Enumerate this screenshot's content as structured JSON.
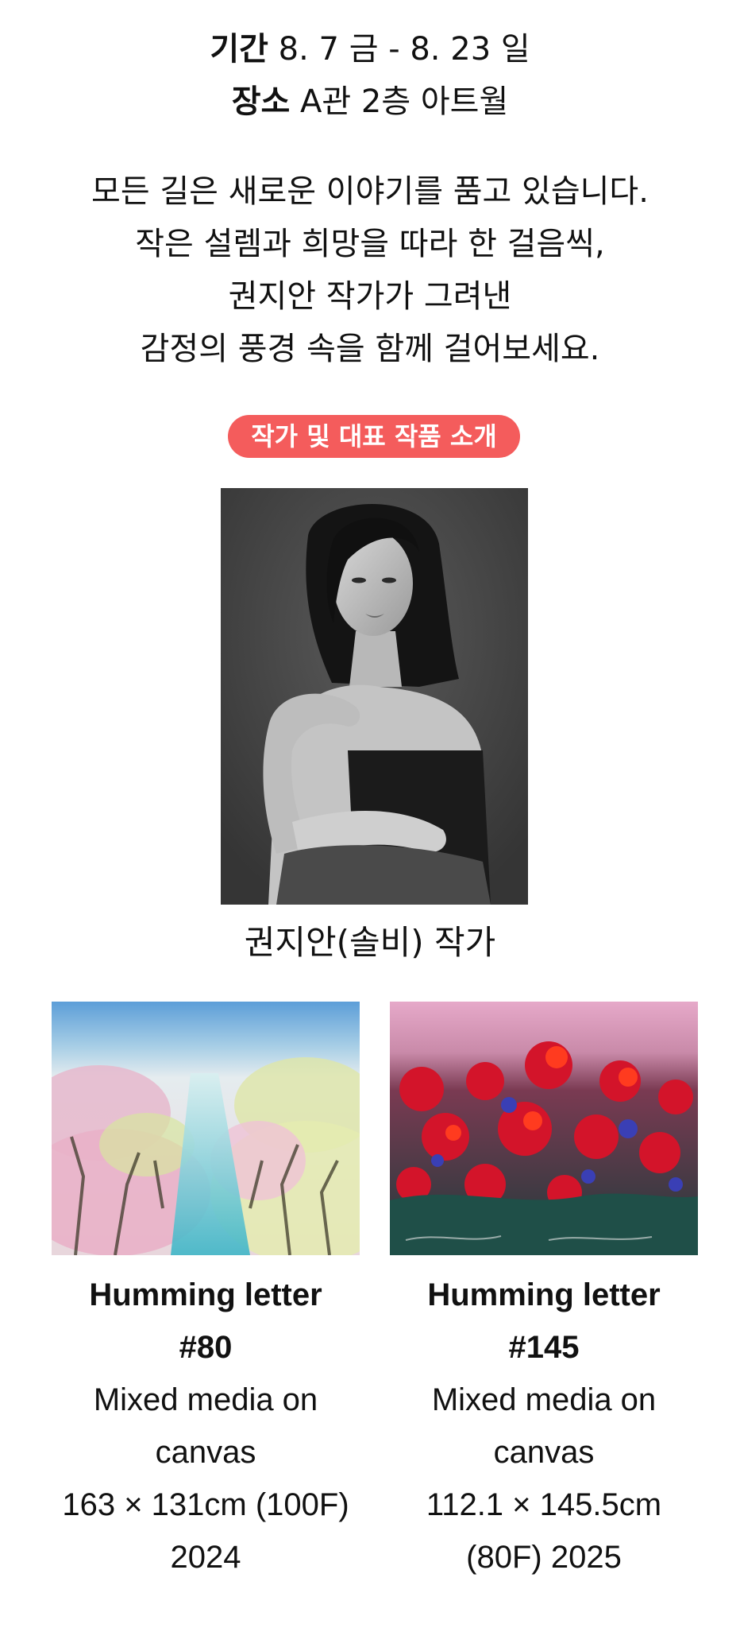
{
  "exhibition": {
    "period_label": "기간",
    "period_value": "8. 7 금 - 8. 23 일",
    "venue_label": "장소",
    "venue_value": "A관 2층 아트월"
  },
  "intro_lines": [
    "모든 길은 새로운 이야기를 품고 있습니다.",
    "작은 설렘과 희망을 따라 한 걸음씩,",
    "권지안 작가가 그려낸",
    "감정의 풍경 속을 함께 걸어보세요."
  ],
  "section_badge": {
    "label": "작가 및 대표 작품 소개",
    "color": "#f45c5c"
  },
  "artist": {
    "caption": "권지안(솔비) 작가"
  },
  "works": [
    {
      "title_line1": "Humming letter",
      "title_line2": "#80",
      "medium_line1": "Mixed media on",
      "medium_line2": "canvas",
      "detail_line1": "163 × 131cm (100F)",
      "detail_line2": "2024"
    },
    {
      "title_line1": "Humming letter",
      "title_line2": "#145",
      "medium_line1": "Mixed media on",
      "medium_line2": "canvas",
      "detail_line1": "112.1 × 145.5cm",
      "detail_line2": "(80F) 2025"
    }
  ]
}
